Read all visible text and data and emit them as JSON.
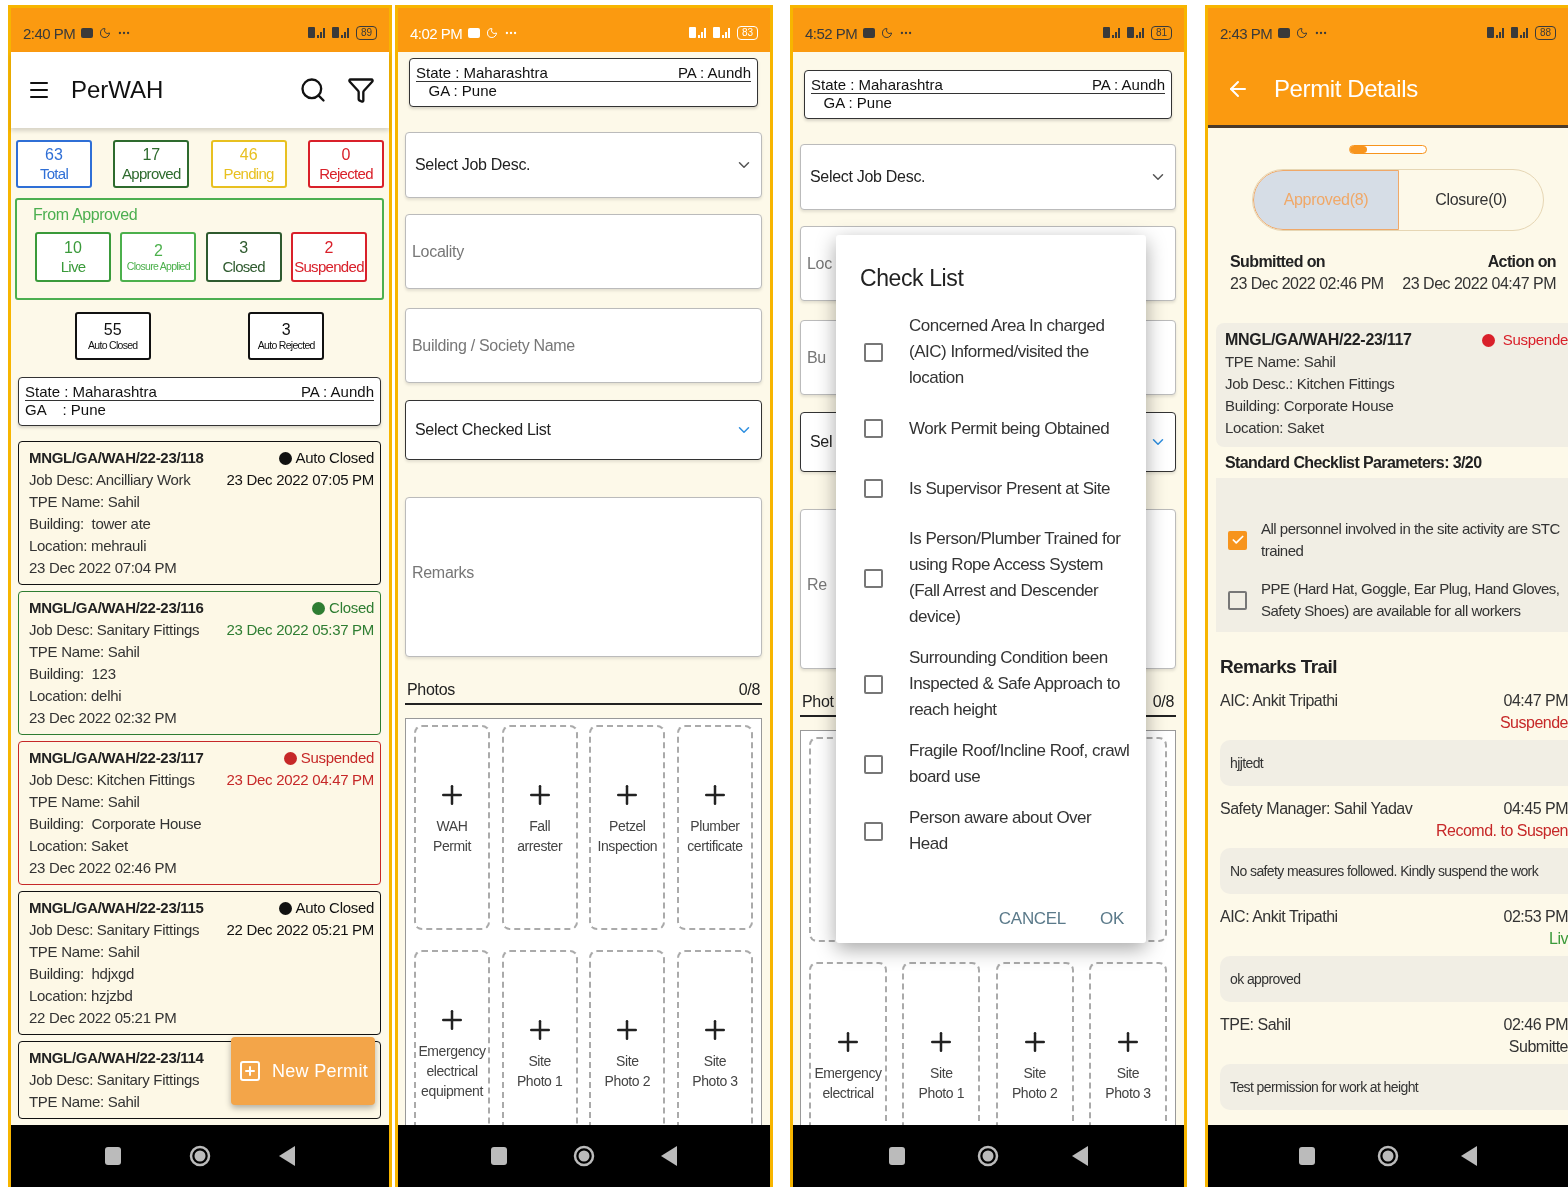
{
  "list_screen": {
    "status_bar": {
      "time": "2:40 PM",
      "battery": "89",
      "light_text": false
    },
    "app_bar": {
      "title": "PerWAH"
    },
    "summary": [
      {
        "count": "63",
        "label": "Total",
        "color": "#2f6fd6"
      },
      {
        "count": "17",
        "label": "Approved",
        "color": "#2e6b2e"
      },
      {
        "count": "46",
        "label": "Pending",
        "color": "#e8c020"
      },
      {
        "count": "0",
        "label": "Rejected",
        "color": "#d9202a"
      }
    ],
    "from_approved": {
      "title": "From Approved",
      "items": [
        {
          "count": "10",
          "label": "Live",
          "color": "#3a9a3a"
        },
        {
          "count": "2",
          "label": "Closure Applied",
          "color": "#4cb04c"
        },
        {
          "count": "3",
          "label": "Closed",
          "color": "#2e5a2e"
        },
        {
          "count": "2",
          "label": "Suspended",
          "color": "#d9202a"
        }
      ]
    },
    "auto": [
      {
        "count": "55",
        "label": "Auto Closed"
      },
      {
        "count": "3",
        "label": "Auto Rejected"
      }
    ],
    "location": {
      "state": "State : Maharashtra",
      "pa": "PA : Aundh",
      "ga": "GA    : Pune"
    },
    "permits": [
      {
        "id": "MNGL/GA/WAH/22-23/118",
        "status": "Auto Closed",
        "action_date": "23 Dec 2022 07:05 PM",
        "color": "#111111",
        "lines": [
          "Job Desc: Ancilliary Work",
          "TPE Name: Sahil",
          "Building:  tower ate",
          "Location: mehrauli",
          "23 Dec 2022 07:04 PM"
        ]
      },
      {
        "id": "MNGL/GA/WAH/22-23/116",
        "status": "Closed",
        "action_date": "23 Dec 2022 05:37 PM",
        "color": "#2e7d32",
        "lines": [
          "Job Desc: Sanitary Fittings",
          "TPE Name: Sahil",
          "Building:  123",
          "Location: delhi",
          "23 Dec 2022 02:32 PM"
        ]
      },
      {
        "id": "MNGL/GA/WAH/22-23/117",
        "status": "Suspended",
        "action_date": "23 Dec 2022 04:47 PM",
        "color": "#c62828",
        "lines": [
          "Job Desc: Kitchen Fittings",
          "TPE Name: Sahil",
          "Building:  Corporate House",
          "Location: Saket",
          "23 Dec 2022 02:46 PM"
        ]
      },
      {
        "id": "MNGL/GA/WAH/22-23/115",
        "status": "Auto Closed",
        "action_date": "22 Dec 2022 05:21 PM",
        "color": "#111111",
        "lines": [
          "Job Desc: Sanitary Fittings",
          "TPE Name: Sahil",
          "Building:  hdjxgd",
          "Location: hzjzbd",
          "22 Dec 2022 05:21 PM"
        ]
      },
      {
        "id": "MNGL/GA/WAH/22-23/114",
        "color": "#111111",
        "lines": [
          "Job Desc: Sanitary Fittings",
          "TPE Name: Sahil"
        ]
      }
    ],
    "fab": {
      "label": "New Permit"
    }
  },
  "form_screen": {
    "status_bar": {
      "time": "4:02 PM",
      "battery": "83",
      "light_text": true
    },
    "location": {
      "state": "State : Maharashtra",
      "pa": "PA : Aundh",
      "ga": "   GA : Pune"
    },
    "fields": [
      {
        "kind": "select",
        "placeholder": "Select Job Desc."
      },
      {
        "kind": "input",
        "placeholder": "Locality"
      },
      {
        "kind": "input",
        "placeholder": "Building / Society Name"
      },
      {
        "kind": "checklist",
        "placeholder": "Select Checked List"
      },
      {
        "kind": "textarea",
        "placeholder": "Remarks"
      }
    ],
    "photos": {
      "title": "Photos",
      "count": "0/8",
      "rows": [
        [
          {
            "label": "WAH Permit"
          },
          {
            "label": "Fall arrester"
          },
          {
            "label": "Petzel Inspection"
          },
          {
            "label": "Plumber certificate"
          }
        ],
        [
          {
            "label": "Emergency electrical equipment"
          },
          {
            "label": "Site Photo 1"
          },
          {
            "label": "Site Photo 2"
          },
          {
            "label": "Site Photo 3"
          }
        ]
      ]
    }
  },
  "checklist_screen": {
    "status_bar": {
      "time": "4:52 PM",
      "battery": "81",
      "light_text": false
    },
    "location": {
      "state": "State : Maharashtra",
      "pa": "PA : Aundh",
      "ga": "   GA : Pune"
    },
    "fields": [
      {
        "kind": "select",
        "placeholder": "Select Job Desc."
      },
      {
        "kind": "input",
        "placeholder": "Loc"
      },
      {
        "kind": "input",
        "placeholder": "Bu"
      },
      {
        "kind": "checklist",
        "placeholder": "Sel"
      },
      {
        "kind": "textarea",
        "placeholder": "Re"
      }
    ],
    "photos": {
      "title": "Phot",
      "count": "0/8",
      "rows": [
        [
          {},
          {},
          {},
          {}
        ],
        [
          {
            "label": "Emergency electrical"
          },
          {
            "label": "Site Photo 1"
          },
          {
            "label": "Site Photo 2"
          },
          {
            "label": "Site Photo 3"
          }
        ]
      ]
    },
    "dialog": {
      "title": "Check List",
      "items": [
        {
          "label": "Concerned Area In charged (AIC) Informed/visited the location",
          "checked": false
        },
        {
          "label": "Work Permit being Obtained",
          "checked": false
        },
        {
          "label": "Is Supervisor Present at Site",
          "checked": false
        },
        {
          "label": "Is Person/Plumber Trained for using Rope Access System (Fall Arrest and Descender device)",
          "checked": false
        },
        {
          "label": "Surrounding Condition been Inspected & Safe Approach to reach height",
          "checked": false
        },
        {
          "label": "Fragile Roof/Incline Roof, crawl board use",
          "checked": false
        },
        {
          "label": "Person aware about Over Head",
          "checked": false
        }
      ],
      "buttons": [
        "CANCEL",
        "OK"
      ]
    }
  },
  "details_screen": {
    "status_bar": {
      "time": "2:43 PM",
      "battery": "88",
      "light_text": false
    },
    "app_bar": {
      "title": "Permit Details"
    },
    "tabs": [
      {
        "label": "Approved(8)",
        "selected": true
      },
      {
        "label": "Closure(0)",
        "selected": false
      }
    ],
    "submitted": {
      "label": "Submitted on",
      "value": "23 Dec 2022 02:46 PM"
    },
    "action": {
      "label": "Action on",
      "value": "23 Dec 2022 04:47 PM"
    },
    "permit": {
      "id": "MNGL/GA/WAH/22-23/117",
      "status": "Suspende",
      "color": "#d9202a",
      "lines": [
        "TPE Name: Sahil",
        "Job Desc.: Kitchen Fittings",
        "Building: Corporate House",
        "Location: Saket"
      ]
    },
    "checklist": {
      "title": "Standard Checklist Parameters: 3/20",
      "items": [
        {
          "label": "All personnel involved in the site activity are STC trained",
          "checked": true
        },
        {
          "label": "PPE (Hard Hat, Goggle, Ear Plug, Hand Gloves, Safety Shoes) are available for all workers",
          "checked": false
        }
      ]
    },
    "remarks": {
      "title": "Remarks Trail",
      "entries": [
        {
          "author": "AIC: Ankit Tripathi",
          "time": "04:47 PM",
          "status": "Suspende",
          "color": "#c62828",
          "text": "hjjtedt"
        },
        {
          "author": "Safety Manager: Sahil Yadav",
          "time": "04:45 PM",
          "status": "Recomd. to Suspen",
          "color": "#c62828",
          "text": "No safety measures followed. Kindly suspend the work"
        },
        {
          "author": "AIC: Ankit Tripathi",
          "time": "02:53 PM",
          "status": "Liv",
          "color": "#3a9a3a",
          "text": "ok approved"
        },
        {
          "author": "TPE: Sahil",
          "time": "02:46 PM",
          "status": "Submitte",
          "color": "#333333",
          "text": "Test permission for work at height"
        }
      ]
    }
  }
}
